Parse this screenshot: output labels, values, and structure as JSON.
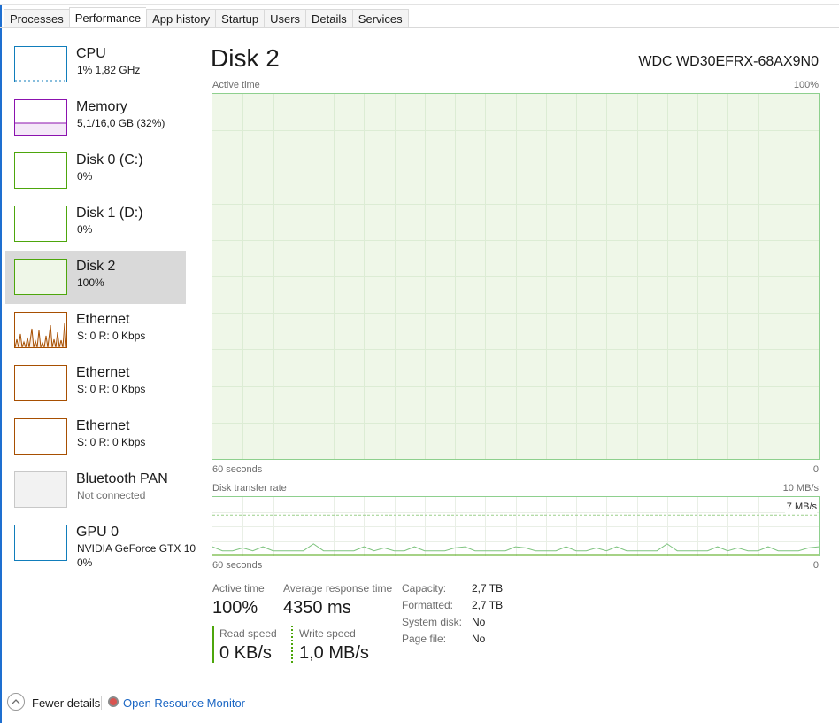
{
  "tabs": [
    "Processes",
    "Performance",
    "App history",
    "Startup",
    "Users",
    "Details",
    "Services"
  ],
  "active_tab": "Performance",
  "sidebar": {
    "items": [
      {
        "title": "CPU",
        "sub": "1%  1,82 GHz",
        "color": "#117dbb"
      },
      {
        "title": "Memory",
        "sub": "5,1/16,0 GB (32%)",
        "color": "#8b12ae"
      },
      {
        "title": "Disk 0 (C:)",
        "sub": "0%",
        "color": "#4da60c"
      },
      {
        "title": "Disk 1 (D:)",
        "sub": "0%",
        "color": "#4da60c"
      },
      {
        "title": "Disk 2",
        "sub": "100%",
        "color": "#4da60c"
      },
      {
        "title": "Ethernet",
        "sub": "S: 0  R: 0 Kbps",
        "color": "#a74f01"
      },
      {
        "title": "Ethernet",
        "sub": "S: 0  R: 0 Kbps",
        "color": "#a74f01"
      },
      {
        "title": "Ethernet",
        "sub": "S: 0  R: 0 Kbps",
        "color": "#a74f01"
      },
      {
        "title": "Bluetooth PAN",
        "sub": "Not connected",
        "color": "#9a9a9a"
      },
      {
        "title": "GPU 0",
        "sub": "NVIDIA GeForce GTX 10",
        "sub2": "0%",
        "color": "#117dbb"
      }
    ],
    "selected_index": 4
  },
  "main": {
    "title": "Disk 2",
    "model": "WDC WD30EFRX-68AX9N0",
    "active_time_graph": {
      "label": "Active time",
      "max_label": "100%",
      "time_label": "60 seconds",
      "min_label": "0",
      "value_percent": 100
    },
    "transfer_graph": {
      "label": "Disk transfer rate",
      "max_label": "10 MB/s",
      "marker_label": "7 MB/s",
      "time_label": "60 seconds",
      "min_label": "0"
    },
    "stats": {
      "active_time_label": "Active time",
      "active_time_value": "100%",
      "avg_response_label": "Average response time",
      "avg_response_value": "4350 ms",
      "read_speed_label": "Read speed",
      "read_speed_value": "0 KB/s",
      "write_speed_label": "Write speed",
      "write_speed_value": "1,0 MB/s"
    },
    "properties": [
      {
        "key": "Capacity:",
        "value": "2,7 TB"
      },
      {
        "key": "Formatted:",
        "value": "2,7 TB"
      },
      {
        "key": "System disk:",
        "value": "No"
      },
      {
        "key": "Page file:",
        "value": "No"
      }
    ]
  },
  "footer": {
    "fewer_details": "Fewer details",
    "open_resource_monitor": "Open Resource Monitor"
  },
  "colors": {
    "disk_fill": "#eff7e8",
    "disk_line": "#8ed08e",
    "grid": "#dcecd4",
    "link": "#1a66c4",
    "selected_bg": "#d9d9d9"
  }
}
